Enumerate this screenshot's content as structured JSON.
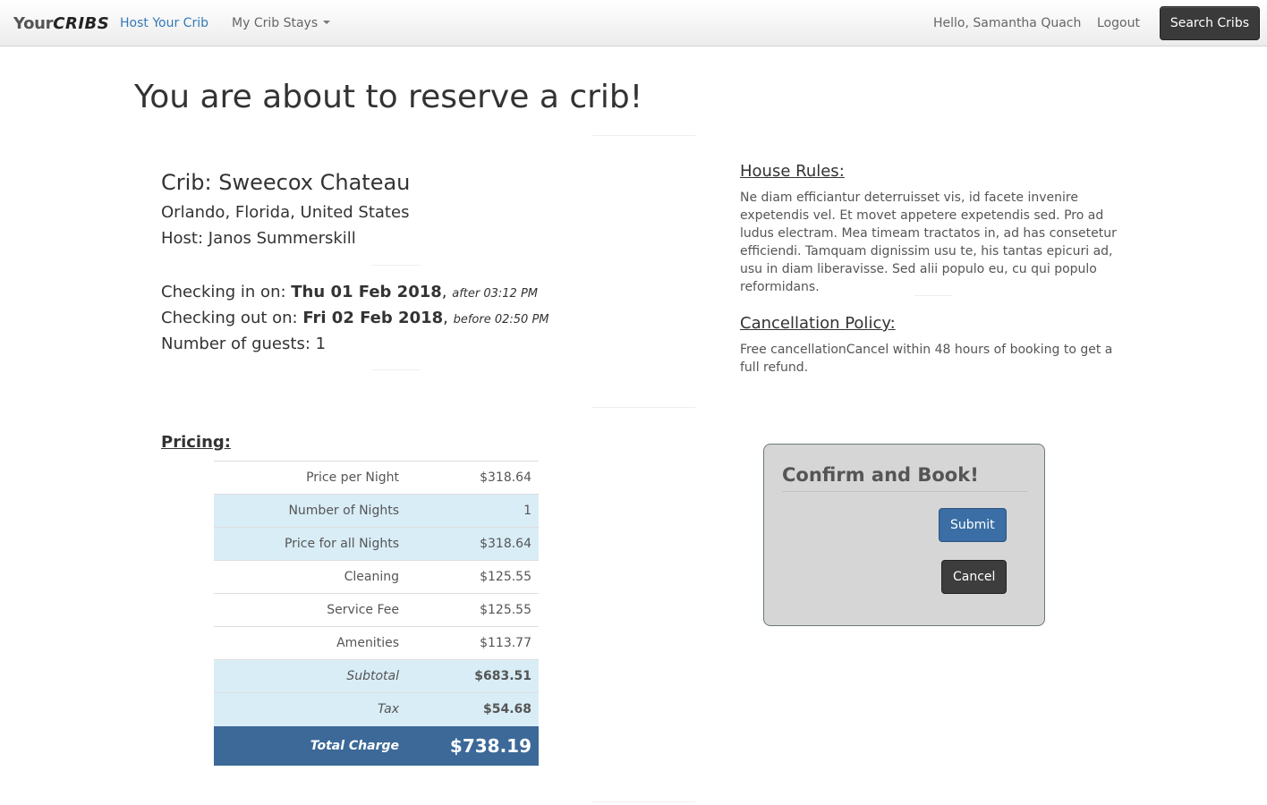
{
  "navbar": {
    "brand_part1": "Your",
    "brand_part2": "CRIBS",
    "host_link": "Host Your Crib",
    "stays_menu": "My Crib Stays",
    "greeting": "Hello, Samantha Quach",
    "logout": "Logout",
    "search_button": "Search Cribs"
  },
  "page": {
    "title": "You are about to reserve a crib!"
  },
  "crib": {
    "name": "Crib: Sweecox Chateau",
    "location": "Orlando, Florida, United States",
    "host": "Host: Janos Summerskill"
  },
  "booking": {
    "checkin_label": "Checking in on: ",
    "checkin_date": "Thu 01 Feb 2018",
    "checkin_time": "after 03:12 PM",
    "checkout_label": "Checking out on: ",
    "checkout_date": "Fri 02 Feb 2018",
    "checkout_time": "before 02:50 PM",
    "guests": "Number of guests: 1"
  },
  "house_rules": {
    "heading": "House Rules:",
    "text": "Ne diam efficiantur deterruisset vis, id facete invenire expetendis vel. Et movet appetere expetendis sed. Pro ad ludus electram. Mea timeam tractatos in, ad has consetetur efficiendi. Tamquam dignissim usu te, his tantas epicuri ad, usu in diam liberavisse. Sed alii populo eu, cu qui populo reformidans."
  },
  "cancellation": {
    "heading": "Cancellation Policy:",
    "text": "Free cancellationCancel within 48 hours of booking to get a full refund."
  },
  "pricing": {
    "heading": "Pricing:",
    "rows": [
      {
        "label": "Price per Night",
        "value": "$318.64"
      },
      {
        "label": "Number of Nights",
        "value": "1"
      },
      {
        "label": "Price for all Nights",
        "value": "$318.64"
      },
      {
        "label": "Cleaning",
        "value": "$125.55"
      },
      {
        "label": "Service Fee",
        "value": "$125.55"
      },
      {
        "label": "Amenities",
        "value": "$113.77"
      },
      {
        "label": "Subtotal",
        "value": "$683.51"
      },
      {
        "label": "Tax",
        "value": "$54.68"
      },
      {
        "label": "Total Charge",
        "value": "$738.19"
      }
    ]
  },
  "confirm": {
    "title": "Confirm and Book!",
    "submit": "Submit",
    "cancel": "Cancel"
  },
  "colors": {
    "accent_link": "#337ab7",
    "table_info_bg": "#d9edf7",
    "total_bg": "#3c6998",
    "submit_bg": "#3a6ea5",
    "dark_button": "#3d3d3d"
  }
}
